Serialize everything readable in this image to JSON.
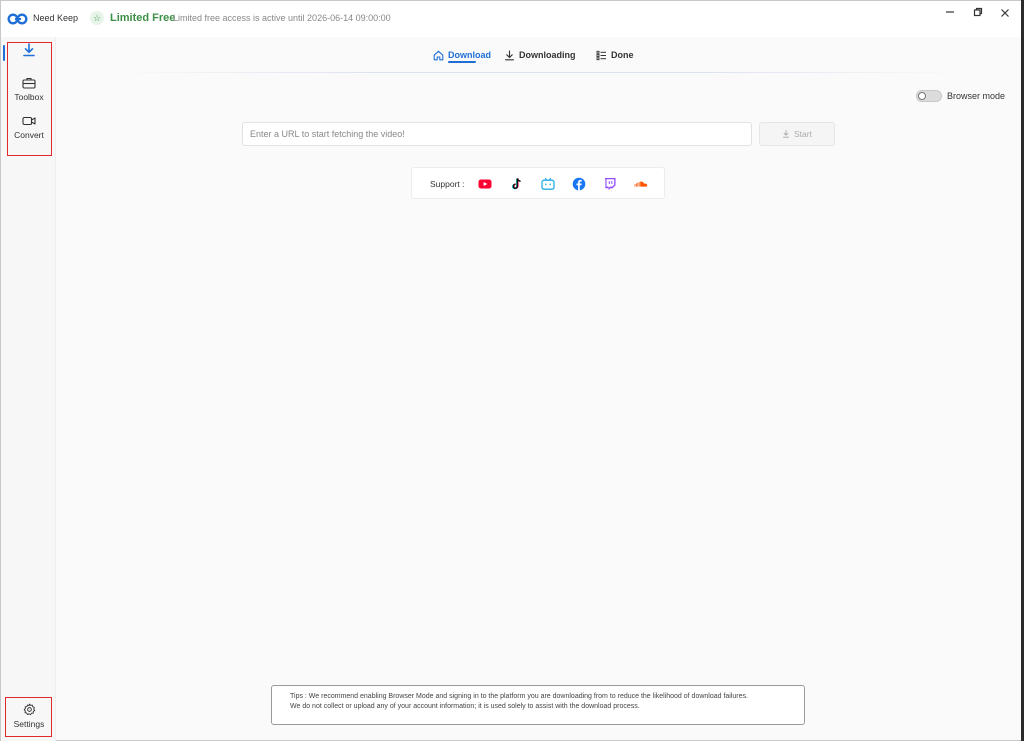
{
  "titlebar": {
    "app_name": "Need Keep",
    "plan_label": "Limited Free",
    "plan_description": "Limited free access is active until 2026-06-14 09:00:00",
    "window_controls": [
      "minimize",
      "restore",
      "close"
    ]
  },
  "sidebar": {
    "items": [
      {
        "name": "download",
        "label": "",
        "icon": "download-icon",
        "active": true
      },
      {
        "name": "toolbox",
        "label": "Toolbox",
        "icon": "toolbox-icon"
      },
      {
        "name": "convert",
        "label": "Convert",
        "icon": "video-camera-icon"
      }
    ],
    "settings_label": "Settings"
  },
  "tabs": [
    {
      "label": "Download",
      "icon": "home-icon",
      "active": true
    },
    {
      "label": "Downloading",
      "icon": "download-arrow-icon"
    },
    {
      "label": "Done",
      "icon": "list-icon"
    }
  ],
  "browser_mode": {
    "label": "Browser mode",
    "enabled": false
  },
  "url_input": {
    "placeholder": "Enter a URL to start fetching the video!",
    "value": ""
  },
  "start_button": {
    "label": "Start",
    "disabled": true
  },
  "support": {
    "label": "Support :",
    "platforms": [
      "youtube-icon",
      "tiktok-icon",
      "bilibili-icon",
      "facebook-icon",
      "twitch-icon",
      "soundcloud-icon"
    ]
  },
  "tips": {
    "line1": "Tips : We recommend enabling Browser Mode and signing in to the platform you are downloading from to reduce the likelihood of download failures.",
    "line2": "We do not collect or upload any of your account information; it is used solely to assist with the download process."
  },
  "colors": {
    "accent": "#1f6fd6",
    "plan_green": "#3c8f46",
    "highlight_red": "#e0292b",
    "youtube": "#ff0033",
    "bilibili": "#23ade5",
    "facebook": "#1877f2",
    "twitch": "#9146ff",
    "soundcloud": "#ff5500"
  }
}
